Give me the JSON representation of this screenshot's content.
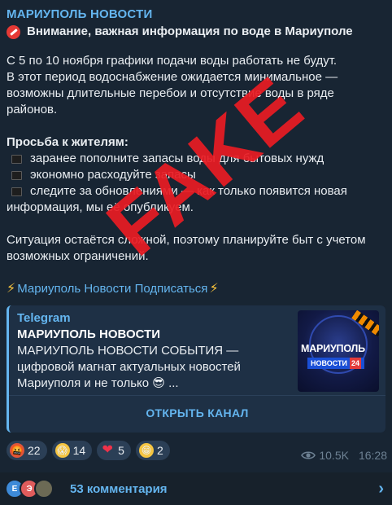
{
  "post": {
    "channel_name": "МАРИУПОЛЬ НОВОСТИ",
    "headline": "Внимание, важная информация по воде в Мариуполе",
    "paragraph1": [
      "С 5 по 10 ноября графики подачи воды работать не будут.",
      "В этот период водоснабжение ожидается минимальное —",
      "возможны длительные перебои и отсутствие воды в ряде",
      "районов."
    ],
    "request_heading": "Просьба к жителям:",
    "bullets": [
      "заранее пополните запасы воды для бытовых нужд",
      "экономно расходуйте запасы",
      "следите за обновлениями — как только появится новая"
    ],
    "bullet_continuation": "информация, мы её опубликуем.",
    "paragraph2": [
      "Ситуация остаётся сложной, поэтому планируйте быт с учетом",
      "возможных ограничений."
    ],
    "subscribe_link": "Мариуполь Новости Подписаться"
  },
  "card": {
    "source": "Telegram",
    "title": "МАРИУПОЛЬ НОВОСТИ",
    "description": [
      "МАРИУПОЛЬ НОВОСТИ СОБЫТИЯ —",
      "цифровой магнат актуальных новостей",
      "Мариуполя и не только 😎 ..."
    ],
    "thumb_title": "МАРИУПОЛЬ",
    "thumb_subtitle": "НОВОСТИ",
    "thumb_badge": "24",
    "button_label": "ОТКРЫТЬ КАНАЛ"
  },
  "reactions": [
    {
      "emoji": "🤬",
      "count": "22"
    },
    {
      "emoji": "😱",
      "count": "14"
    },
    {
      "emoji": "❤",
      "count": "5"
    },
    {
      "emoji": "😁",
      "count": "2"
    }
  ],
  "meta": {
    "views": "10.5K",
    "time": "16:28"
  },
  "comments": {
    "avatars": [
      "Е",
      "Э",
      ""
    ],
    "label": "53 комментария"
  },
  "overlay": {
    "stamp": "FAKE"
  },
  "colors": {
    "accent": "#64b5ef",
    "stamp": "#e81c24",
    "background": "#182533"
  }
}
